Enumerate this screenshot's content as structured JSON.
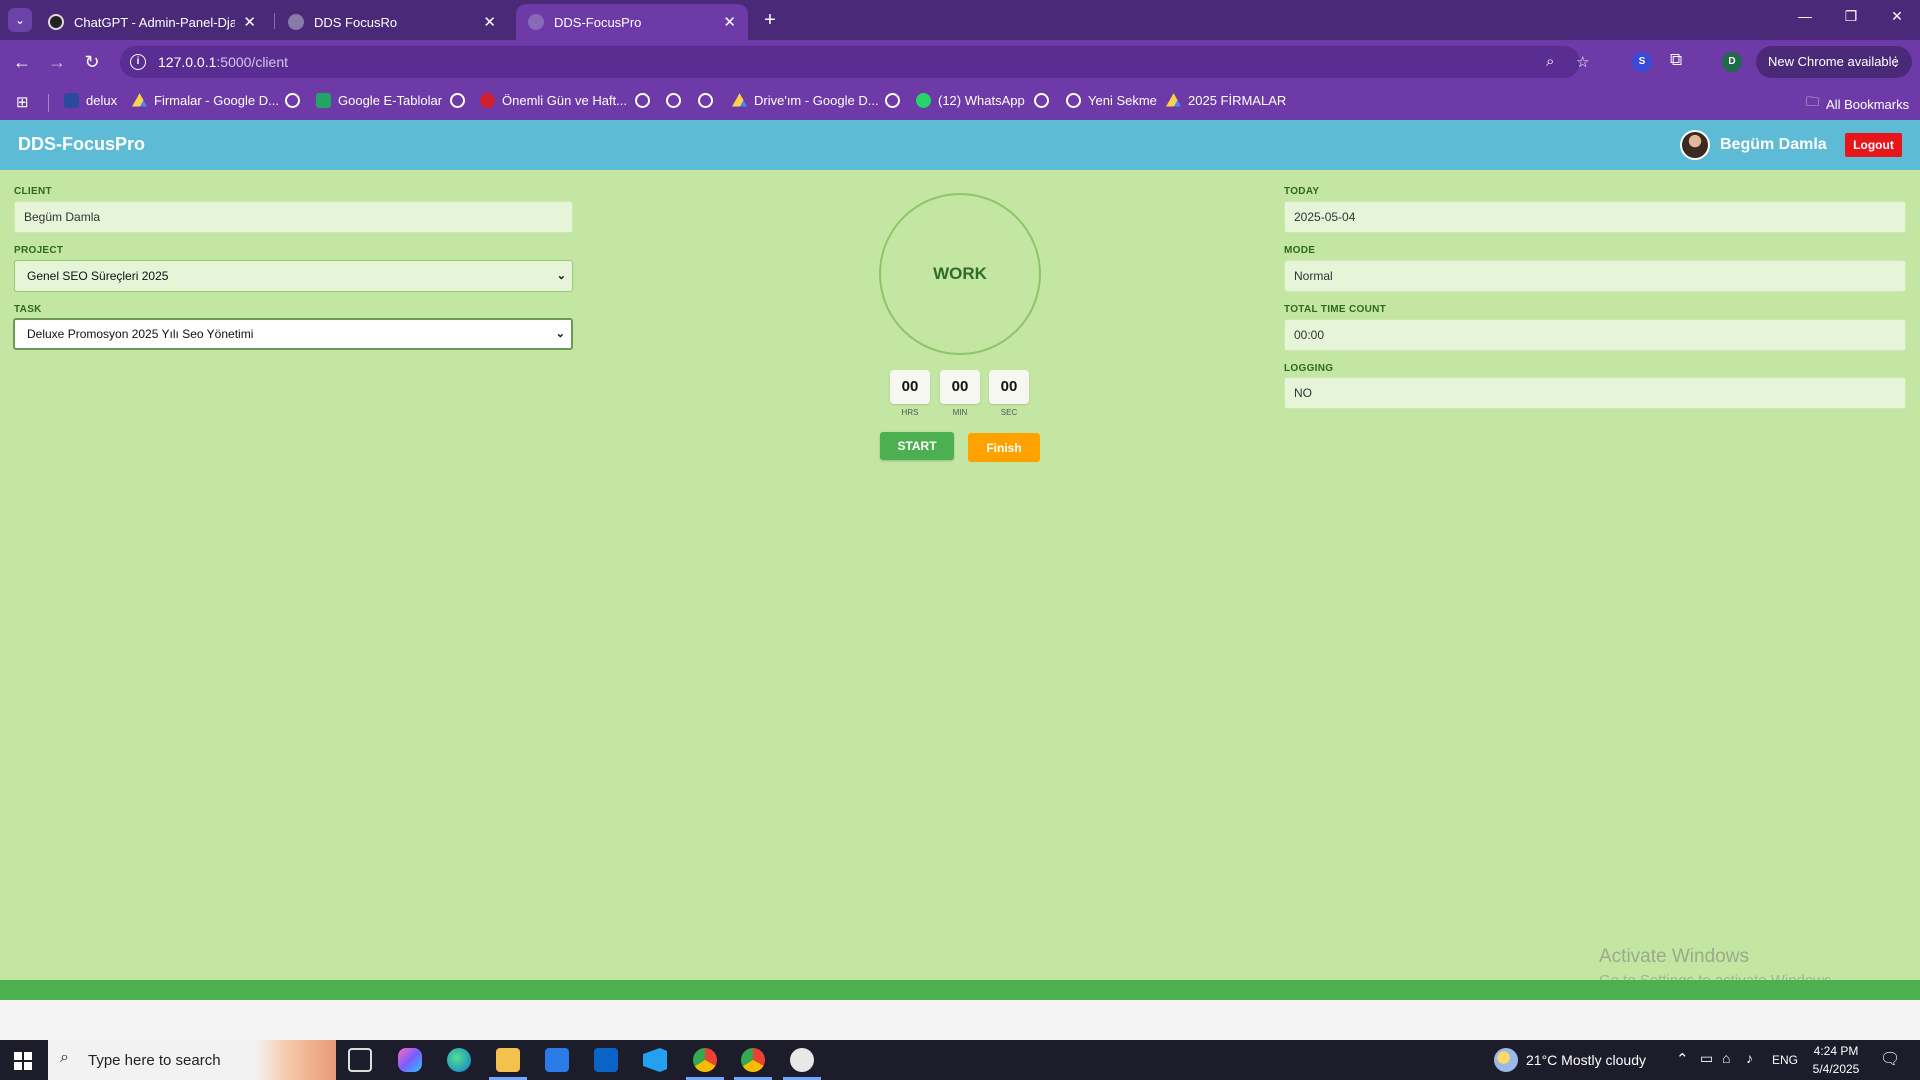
{
  "browser": {
    "tabs": [
      {
        "title": "ChatGPT - Admin-Panel-Django"
      },
      {
        "title": "DDS FocusRo"
      },
      {
        "title": "DDS-FocusPro"
      }
    ],
    "url_host": "127.0.0.1",
    "url_path": ":5000/client",
    "new_chrome_label": "New Chrome available",
    "profile_initial": "D",
    "extension_initial": "S",
    "bookmarks": [
      "delux",
      "Firmalar - Google D...",
      "Google E-Tablolar",
      "Önemli Gün ve Haft...",
      "Drive'ım - Google D...",
      "(12) WhatsApp",
      "Yeni Sekme",
      "2025 FİRMALAR"
    ],
    "all_bookmarks": "All Bookmarks"
  },
  "app": {
    "brand": "DDS-FocusPro",
    "user_name": "Begüm Damla",
    "logout_label": "Logout",
    "client_label": "CLIENT",
    "client_value": "Begüm Damla",
    "project_label": "PROJECT",
    "project_value": "Genel SEO Süreçleri 2025",
    "task_label": "TASK",
    "task_value": "Deluxe Promosyon 2025 Yılı Seo Yönetimi",
    "today_label": "TODAY",
    "today_value": "2025-05-04",
    "mode_label": "MODE",
    "mode_value": "Normal",
    "total_label": "TOTAL TIME COUNT",
    "total_value": "00:00",
    "logging_label": "LOGGING",
    "logging_value": "NO",
    "work_label": "WORK",
    "timer": {
      "hrs": "00",
      "min": "00",
      "sec": "00",
      "hrs_label": "HRS",
      "min_label": "MIN",
      "sec_label": "SEC"
    },
    "start_label": "START",
    "finish_label": "Finish"
  },
  "watermark": {
    "line1": "Activate Windows",
    "line2": "Go to Settings to activate Windows."
  },
  "taskbar": {
    "search_placeholder": "Type here to search",
    "weather": "21°C  Mostly cloudy",
    "lang": "ENG",
    "time": "4:24 PM",
    "date": "5/4/2025"
  },
  "colors": {
    "header": "#5dbbd6",
    "page": "#c3e6a2",
    "start": "#4caf50",
    "finish": "#ffa200",
    "logout": "#e8151b",
    "chrome": "#6d3aa8"
  }
}
